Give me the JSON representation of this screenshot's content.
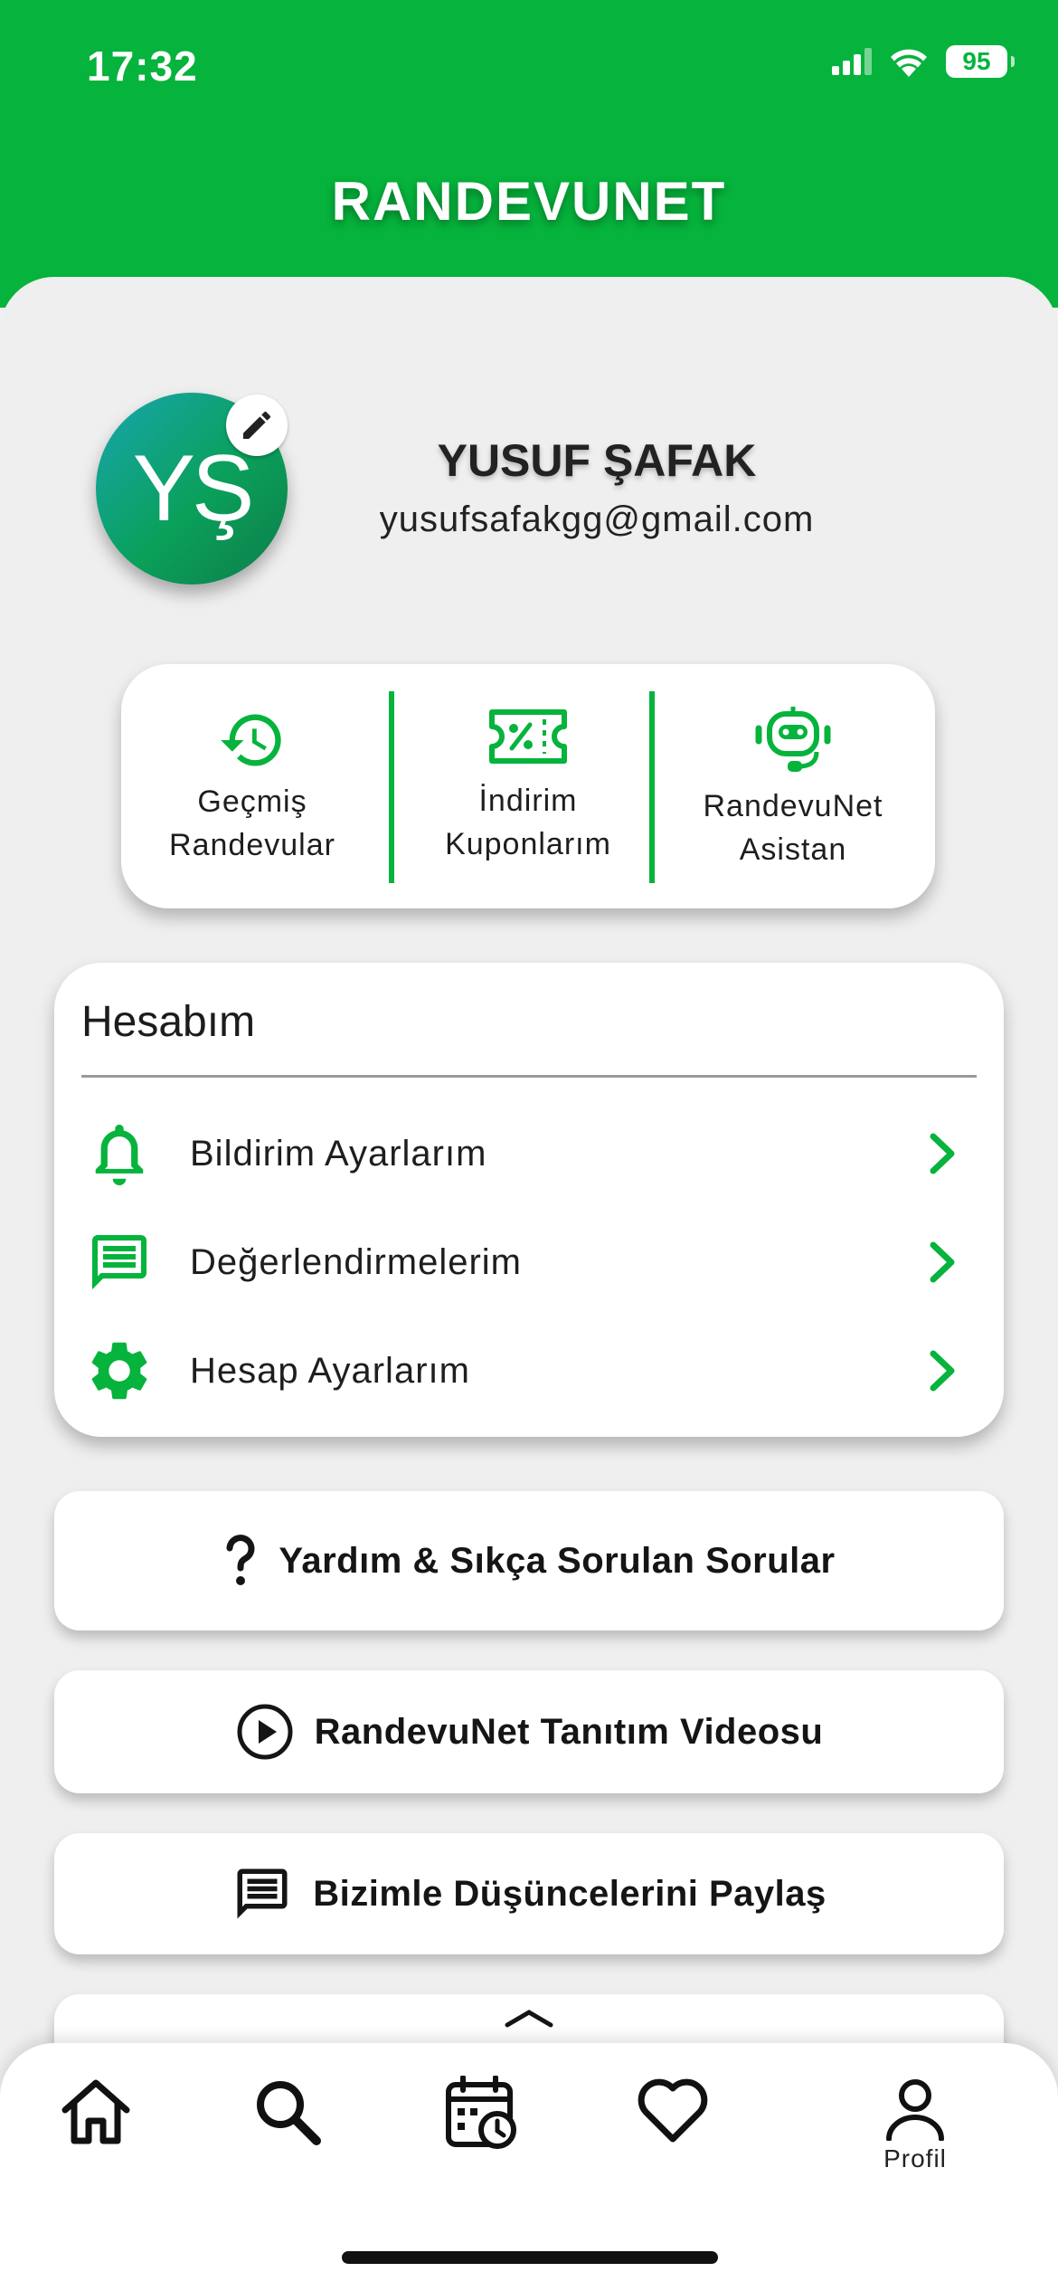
{
  "status_bar": {
    "time": "17:32",
    "battery": "95"
  },
  "header": {
    "title": "RANDEVUNET"
  },
  "profile": {
    "initials": "YŞ",
    "name": "YUSUF ŞAFAK",
    "email": "yusufsafakgg@gmail.com"
  },
  "quick_actions": [
    {
      "label_1": "Geçmiş",
      "label_2": "Randevular",
      "icon": "history-icon"
    },
    {
      "label_1": "İndirim",
      "label_2": "Kuponlarım",
      "icon": "coupon-icon"
    },
    {
      "label_1": "RandevuNet",
      "label_2": "Asistan",
      "icon": "robot-icon"
    }
  ],
  "account": {
    "title": "Hesabım",
    "items": [
      {
        "label": "Bildirim Ayarlarım",
        "icon": "bell-icon"
      },
      {
        "label": "Değerlendirmelerim",
        "icon": "comment-icon"
      },
      {
        "label": "Hesap Ayarlarım",
        "icon": "gear-icon"
      }
    ]
  },
  "buttons": {
    "faq": "Yardım & Sıkça Sorulan Sorular",
    "video": "RandevuNet Tanıtım Videosu",
    "feedback": "Bizimle Düşüncelerini Paylaş"
  },
  "tabbar": {
    "profile_label": "Profil"
  },
  "colors": {
    "brand_green": "#06b33c",
    "background": "#efefef"
  }
}
